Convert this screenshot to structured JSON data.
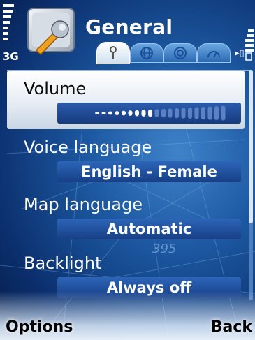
{
  "status": {
    "network": "3G"
  },
  "header": {
    "title": "General"
  },
  "tabs": [
    {
      "icon": "settings-key-icon",
      "active": true
    },
    {
      "icon": "globe-icon",
      "active": false
    },
    {
      "icon": "target-icon",
      "active": false
    },
    {
      "icon": "speedometer-icon",
      "active": false
    }
  ],
  "settings": [
    {
      "label": "Volume",
      "value": "",
      "level": 0.45
    },
    {
      "label": "Voice language",
      "value": "English - Female"
    },
    {
      "label": "Map language",
      "value": "Automatic"
    },
    {
      "label": "Backlight",
      "value": "Always off"
    }
  ],
  "map_text": "395",
  "softkeys": {
    "left": "Options",
    "right": "Back"
  },
  "colors": {
    "accent": "#1d5aa3",
    "selected": "#e6edf4",
    "value_box": "#2d65b8"
  }
}
